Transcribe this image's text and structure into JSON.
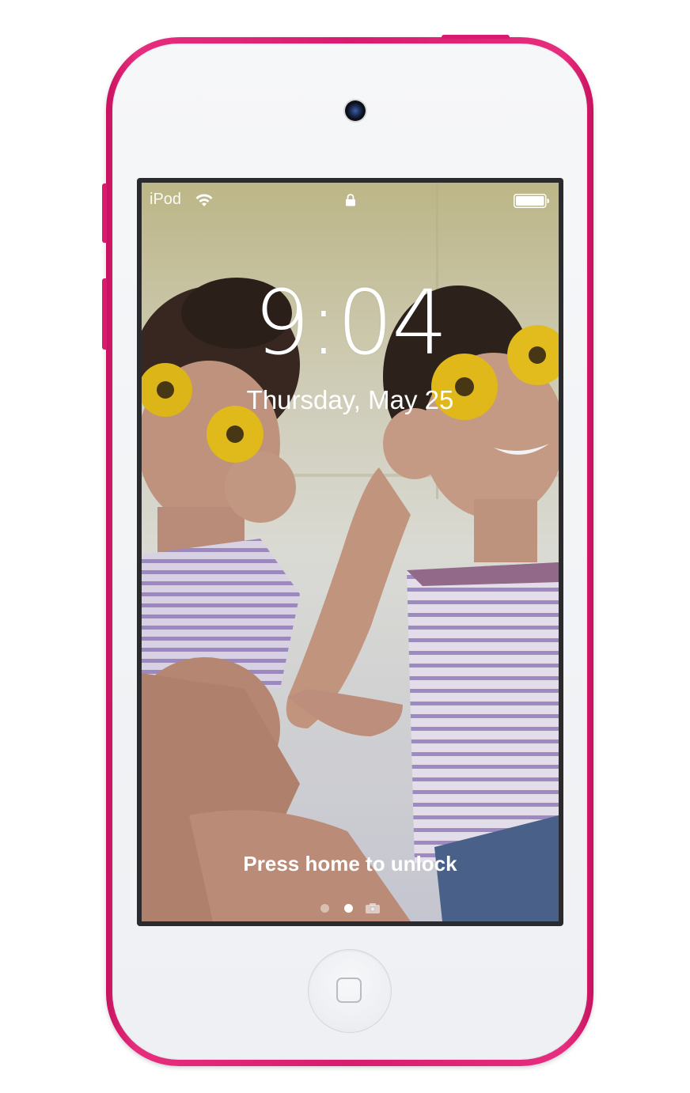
{
  "device": {
    "color": "#d81b6e",
    "face_color": "#f3f4f6"
  },
  "status_bar": {
    "carrier": "iPod",
    "wifi_icon": "wifi-icon",
    "lock_icon": "lock-icon",
    "battery_icon": "battery-icon"
  },
  "lock_screen": {
    "time": "9:04",
    "date": "Thursday, May 25",
    "unlock_hint": "Press home to unlock",
    "page_indicator": {
      "pages": 2,
      "current_page": 2,
      "camera_icon": "camera-icon"
    }
  },
  "home_button": {
    "icon": "home-square-icon"
  }
}
